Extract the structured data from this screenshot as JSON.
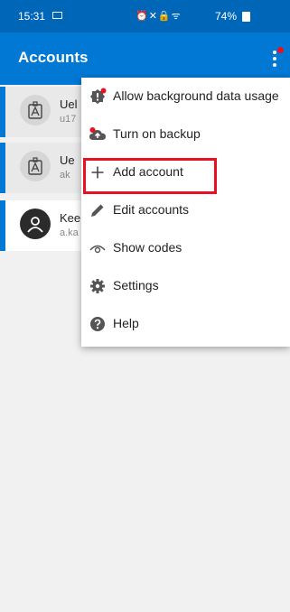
{
  "status_bar": {
    "time": "15:31",
    "icons": "⏰✕🔒ᯤ",
    "battery": "74%"
  },
  "app_bar": {
    "title": "Accounts"
  },
  "accounts": [
    {
      "name": "Uel",
      "sub": "u17"
    },
    {
      "name": "Ue",
      "sub": "ak"
    },
    {
      "name": "Kee",
      "sub": "a.ka"
    }
  ],
  "menu": {
    "items": [
      {
        "label": "Allow background data usage",
        "icon": "badge-alert-icon"
      },
      {
        "label": "Turn on backup",
        "icon": "cloud-upload-icon"
      },
      {
        "label": "Add account",
        "icon": "plus-icon"
      },
      {
        "label": "Edit accounts",
        "icon": "pencil-icon"
      },
      {
        "label": "Show codes",
        "icon": "eye-icon"
      },
      {
        "label": "Settings",
        "icon": "gear-icon"
      },
      {
        "label": "Help",
        "icon": "help-icon"
      }
    ]
  },
  "colors": {
    "primary": "#0078d4",
    "status_bar": "#0067b8",
    "badge": "#e81123",
    "highlight": "#e81123"
  }
}
